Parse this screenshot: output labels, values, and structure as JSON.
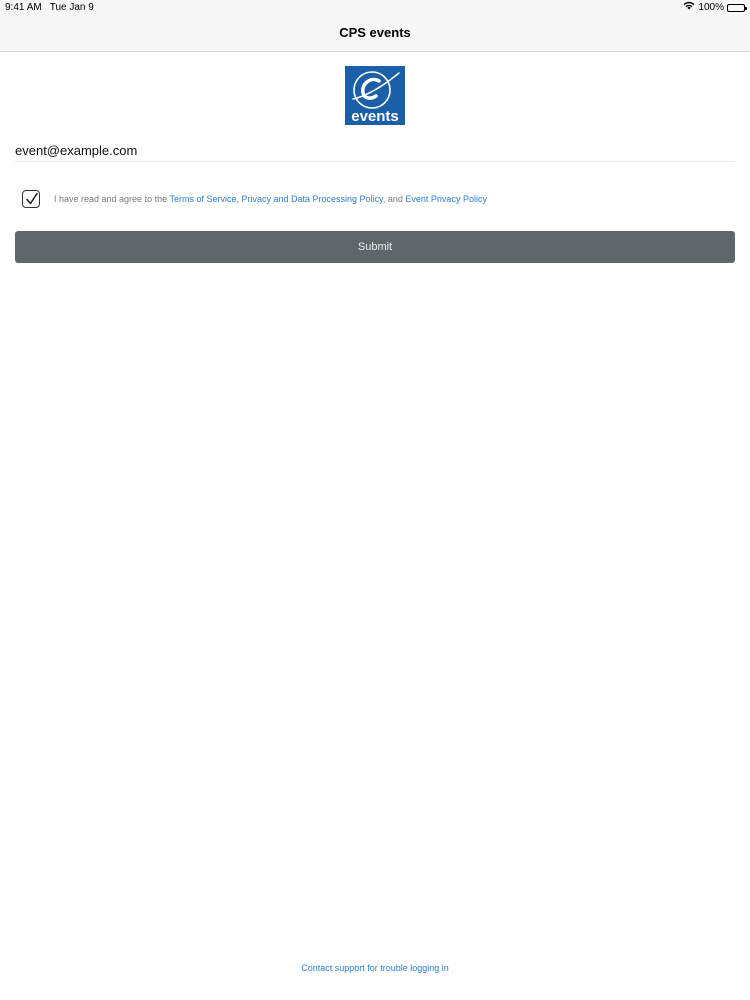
{
  "status_bar": {
    "time": "9:41 AM",
    "date": "Tue Jan 9",
    "battery": "100%",
    "wifi_icon": "wifi-icon",
    "battery_icon": "battery-icon"
  },
  "nav": {
    "title": "CPS events"
  },
  "logo": {
    "text": "events",
    "background": "#1b5fa8"
  },
  "form": {
    "email_value": "event@example.com",
    "email_placeholder": "",
    "agree_checked": true,
    "agree_prefix": "I have read and agree to the ",
    "terms_link": "Terms of Service",
    "sep1": ", ",
    "privacy_link": "Privacy and Data Processing Policy",
    "sep2": ", and ",
    "event_privacy_link": "Event Privacy Policy",
    "submit_label": "Submit"
  },
  "footer": {
    "support_link": "Contact support for trouble logging in"
  },
  "colors": {
    "link": "#2a7fd4",
    "button_bg": "#5e6669",
    "bar_bg": "#f7f7f8"
  }
}
